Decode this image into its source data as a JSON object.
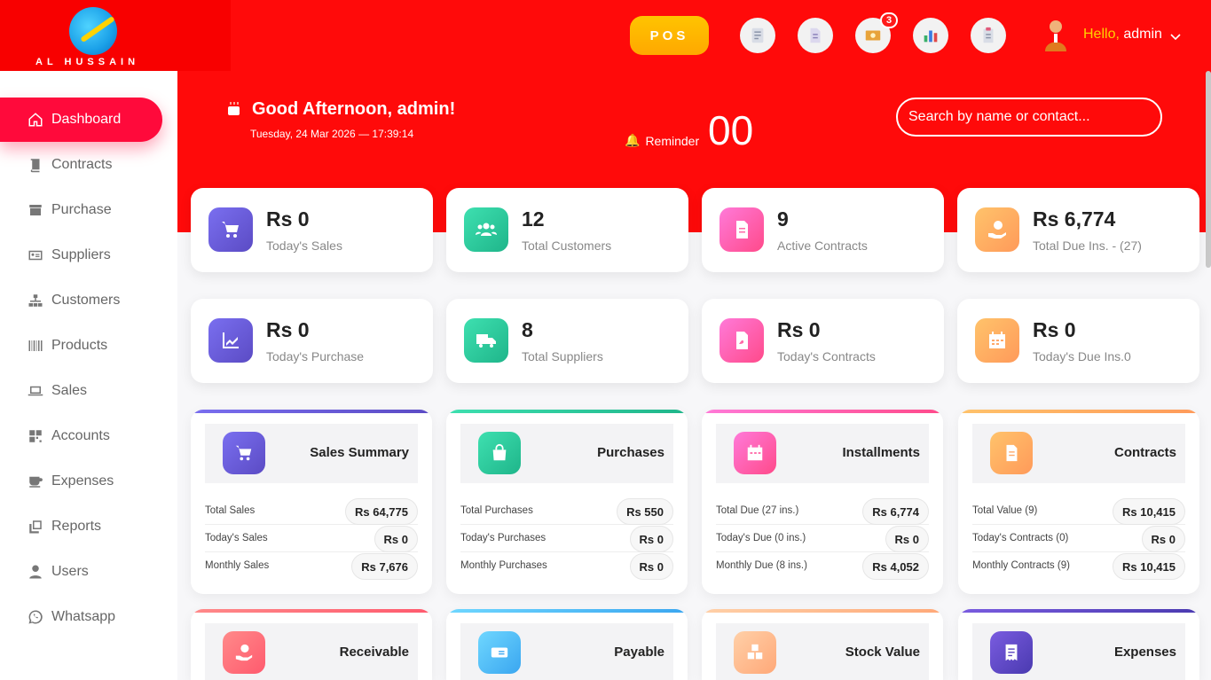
{
  "header": {
    "logo_text": "AL HUSSAIN",
    "pos_label": "POS",
    "notification_count": "3",
    "greeting_prefix": "Hello,",
    "user_name": "admin"
  },
  "sidebar": {
    "items": [
      {
        "label": "Dashboard",
        "icon": "home-icon"
      },
      {
        "label": "Contracts",
        "icon": "book-icon"
      },
      {
        "label": "Purchase",
        "icon": "archive-icon"
      },
      {
        "label": "Suppliers",
        "icon": "id-card-icon"
      },
      {
        "label": "Customers",
        "icon": "sitemap-icon"
      },
      {
        "label": "Products",
        "icon": "barcode-icon"
      },
      {
        "label": "Sales",
        "icon": "laptop-icon"
      },
      {
        "label": "Accounts",
        "icon": "grid-icon"
      },
      {
        "label": "Expenses",
        "icon": "coffee-icon"
      },
      {
        "label": "Reports",
        "icon": "copy-icon"
      },
      {
        "label": "Users",
        "icon": "user-icon"
      },
      {
        "label": "Whatsapp",
        "icon": "whatsapp-icon"
      }
    ]
  },
  "hero": {
    "greeting": "Good Afternoon, admin!",
    "datetime": "Tuesday, 24 Mar 2026 — 17:39:14",
    "reminder_label": "Reminder",
    "reminder_count": "00",
    "search_placeholder": "Search by name or contact..."
  },
  "stats": [
    {
      "value": "Rs 0",
      "label": "Today's Sales",
      "icon": "cart-icon"
    },
    {
      "value": "12",
      "label": "Total Customers",
      "icon": "users-icon"
    },
    {
      "value": "9",
      "label": "Active Contracts",
      "icon": "contract-icon"
    },
    {
      "value": "Rs 6,774",
      "label": "Total Due Ins. - (27)",
      "icon": "hand-money-icon"
    },
    {
      "value": "Rs 0",
      "label": "Today's Purchase",
      "icon": "chart-line-icon"
    },
    {
      "value": "8",
      "label": "Total Suppliers",
      "icon": "truck-icon"
    },
    {
      "value": "Rs 0",
      "label": "Today's Contracts",
      "icon": "pdf-icon"
    },
    {
      "value": "Rs 0",
      "label": "Today's Due Ins.0",
      "icon": "calendar-icon"
    }
  ],
  "panels": [
    {
      "title": "Sales Summary",
      "icon": "cart-icon",
      "rows": [
        {
          "label": "Total Sales",
          "value": "Rs 64,775"
        },
        {
          "label": "Today's Sales",
          "value": "Rs 0"
        },
        {
          "label": "Monthly Sales",
          "value": "Rs 7,676"
        }
      ]
    },
    {
      "title": "Purchases",
      "icon": "bag-icon",
      "rows": [
        {
          "label": "Total Purchases",
          "value": "Rs 550"
        },
        {
          "label": "Today's Purchases",
          "value": "Rs 0"
        },
        {
          "label": "Monthly Purchases",
          "value": "Rs 0"
        }
      ]
    },
    {
      "title": "Installments",
      "icon": "calendar-icon",
      "rows": [
        {
          "label": "Total Due (27 ins.)",
          "value": "Rs 6,774"
        },
        {
          "label": "Today's Due (0 ins.)",
          "value": "Rs 0"
        },
        {
          "label": "Monthly Due (8 ins.)",
          "value": "Rs 4,052"
        }
      ]
    },
    {
      "title": "Contracts",
      "icon": "contract-icon",
      "rows": [
        {
          "label": "Total Value (9)",
          "value": "Rs 10,415"
        },
        {
          "label": "Today's Contracts (0)",
          "value": "Rs 0"
        },
        {
          "label": "Monthly Contracts (9)",
          "value": "Rs 10,415"
        }
      ]
    },
    {
      "title": "Receivable",
      "icon": "hand-money-icon",
      "rows": []
    },
    {
      "title": "Payable",
      "icon": "money-card-icon",
      "rows": []
    },
    {
      "title": "Stock Value",
      "icon": "boxes-icon",
      "rows": []
    },
    {
      "title": "Expenses",
      "icon": "receipt-icon",
      "rows": []
    }
  ],
  "colors": {
    "brand_red": "#ff0a0a",
    "active_nav": "#ff0a3b",
    "pos_yellow": "#ffb400",
    "hello_yellow": "#ffd200"
  }
}
